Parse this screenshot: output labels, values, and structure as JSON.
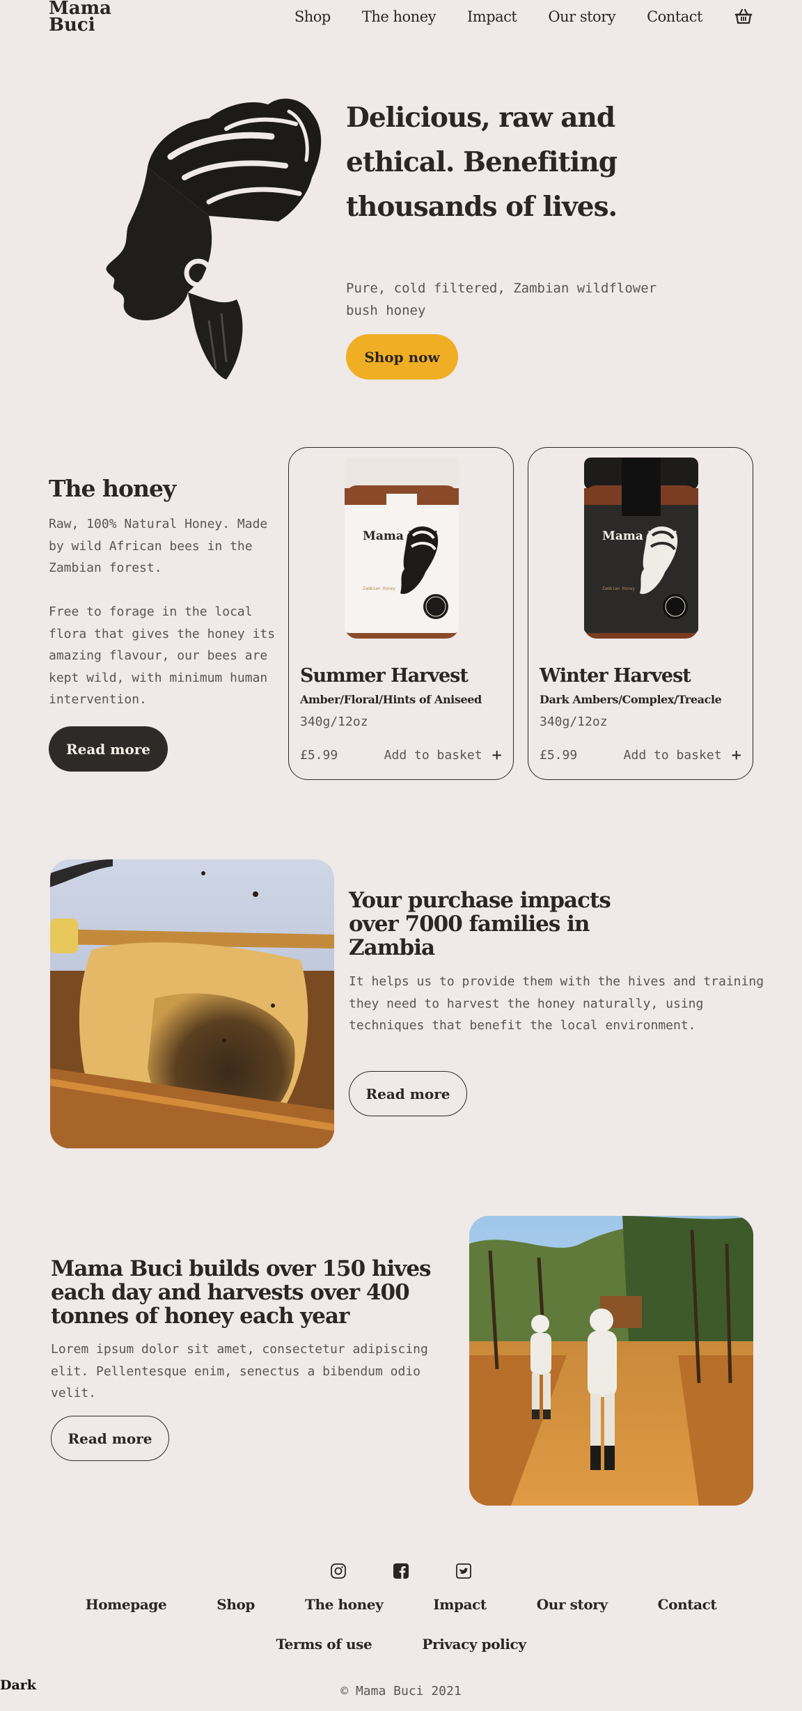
{
  "header": {
    "logo_line1": "Mama",
    "logo_line2": "Buci",
    "nav": [
      "Shop",
      "The honey",
      "Impact",
      "Our story",
      "Contact"
    ],
    "basket_icon": "basket-icon"
  },
  "hero": {
    "title": "Delicious, raw and ethical. Benefiting thousands of lives.",
    "subtitle": "Pure, cold filtered, Zambian wildflower bush honey",
    "cta": "Shop now"
  },
  "honey": {
    "title": "The honey",
    "paragraph1": "Raw, 100% Natural Honey. Made by wild African bees in the Zambian forest.",
    "paragraph2": "Free to forage in the local flora that gives the honey its amazing flavour, our bees are kept wild, with minimum human intervention.",
    "cta": "Read more",
    "products": [
      {
        "name": "Summer Harvest",
        "notes": "Amber/Floral/Hints of Aniseed",
        "weight": "340g/12oz",
        "price": "£5.99",
        "add": "Add to basket",
        "jar_label": "Mama Buci",
        "jar_sublabel": "Zambian Honey",
        "jar_lid": "#ece7e2",
        "jar_body": "#f4f1ee"
      },
      {
        "name": "Winter Harvest",
        "notes": "Dark Ambers/Complex/Treacle",
        "weight": "340g/12oz",
        "price": "£5.99",
        "add": "Add to basket",
        "jar_label": "Mama Buci",
        "jar_sublabel": "Zambian Honey",
        "jar_lid": "#1e1c1b",
        "jar_body": "#2b2a29"
      }
    ]
  },
  "impact": {
    "title": "Your purchase impacts over 7000 families in Zambia",
    "text": "It helps us to provide them with the hives and training they need to harvest the honey naturally, using techniques that benefit the local environment.",
    "cta": "Read more"
  },
  "hives": {
    "title": "Mama Buci builds over 150 hives each day and harvests over 400 tonnes of honey each year",
    "text": "Lorem ipsum dolor sit amet, consectetur adipiscing elit. Pellentesque enim, senectus a bibendum odio velit.",
    "cta": "Read more"
  },
  "footer": {
    "social": [
      "instagram-icon",
      "facebook-icon",
      "twitter-icon"
    ],
    "nav": [
      "Homepage",
      "Shop",
      "The honey",
      "Impact",
      "Our story",
      "Contact"
    ],
    "legal": [
      "Terms of use",
      "Privacy policy"
    ],
    "dark_toggle": "Dark",
    "copyright": "© Mama Buci 2021"
  },
  "colors": {
    "background": "#efe9e7",
    "accent": "#f0ae24",
    "text": "#2a2623",
    "dark_button": "#2d2a28"
  }
}
